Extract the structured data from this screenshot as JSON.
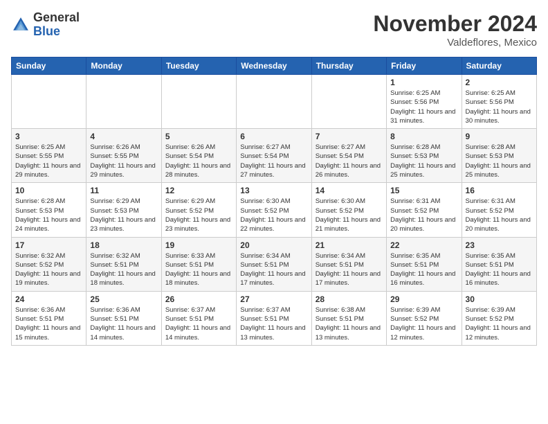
{
  "header": {
    "logo_general": "General",
    "logo_blue": "Blue",
    "month_title": "November 2024",
    "location": "Valdeflores, Mexico"
  },
  "days_of_week": [
    "Sunday",
    "Monday",
    "Tuesday",
    "Wednesday",
    "Thursday",
    "Friday",
    "Saturday"
  ],
  "weeks": [
    [
      {
        "day": "",
        "info": ""
      },
      {
        "day": "",
        "info": ""
      },
      {
        "day": "",
        "info": ""
      },
      {
        "day": "",
        "info": ""
      },
      {
        "day": "",
        "info": ""
      },
      {
        "day": "1",
        "info": "Sunrise: 6:25 AM\nSunset: 5:56 PM\nDaylight: 11 hours and 31 minutes."
      },
      {
        "day": "2",
        "info": "Sunrise: 6:25 AM\nSunset: 5:56 PM\nDaylight: 11 hours and 30 minutes."
      }
    ],
    [
      {
        "day": "3",
        "info": "Sunrise: 6:25 AM\nSunset: 5:55 PM\nDaylight: 11 hours and 29 minutes."
      },
      {
        "day": "4",
        "info": "Sunrise: 6:26 AM\nSunset: 5:55 PM\nDaylight: 11 hours and 29 minutes."
      },
      {
        "day": "5",
        "info": "Sunrise: 6:26 AM\nSunset: 5:54 PM\nDaylight: 11 hours and 28 minutes."
      },
      {
        "day": "6",
        "info": "Sunrise: 6:27 AM\nSunset: 5:54 PM\nDaylight: 11 hours and 27 minutes."
      },
      {
        "day": "7",
        "info": "Sunrise: 6:27 AM\nSunset: 5:54 PM\nDaylight: 11 hours and 26 minutes."
      },
      {
        "day": "8",
        "info": "Sunrise: 6:28 AM\nSunset: 5:53 PM\nDaylight: 11 hours and 25 minutes."
      },
      {
        "day": "9",
        "info": "Sunrise: 6:28 AM\nSunset: 5:53 PM\nDaylight: 11 hours and 25 minutes."
      }
    ],
    [
      {
        "day": "10",
        "info": "Sunrise: 6:28 AM\nSunset: 5:53 PM\nDaylight: 11 hours and 24 minutes."
      },
      {
        "day": "11",
        "info": "Sunrise: 6:29 AM\nSunset: 5:53 PM\nDaylight: 11 hours and 23 minutes."
      },
      {
        "day": "12",
        "info": "Sunrise: 6:29 AM\nSunset: 5:52 PM\nDaylight: 11 hours and 23 minutes."
      },
      {
        "day": "13",
        "info": "Sunrise: 6:30 AM\nSunset: 5:52 PM\nDaylight: 11 hours and 22 minutes."
      },
      {
        "day": "14",
        "info": "Sunrise: 6:30 AM\nSunset: 5:52 PM\nDaylight: 11 hours and 21 minutes."
      },
      {
        "day": "15",
        "info": "Sunrise: 6:31 AM\nSunset: 5:52 PM\nDaylight: 11 hours and 20 minutes."
      },
      {
        "day": "16",
        "info": "Sunrise: 6:31 AM\nSunset: 5:52 PM\nDaylight: 11 hours and 20 minutes."
      }
    ],
    [
      {
        "day": "17",
        "info": "Sunrise: 6:32 AM\nSunset: 5:52 PM\nDaylight: 11 hours and 19 minutes."
      },
      {
        "day": "18",
        "info": "Sunrise: 6:32 AM\nSunset: 5:51 PM\nDaylight: 11 hours and 18 minutes."
      },
      {
        "day": "19",
        "info": "Sunrise: 6:33 AM\nSunset: 5:51 PM\nDaylight: 11 hours and 18 minutes."
      },
      {
        "day": "20",
        "info": "Sunrise: 6:34 AM\nSunset: 5:51 PM\nDaylight: 11 hours and 17 minutes."
      },
      {
        "day": "21",
        "info": "Sunrise: 6:34 AM\nSunset: 5:51 PM\nDaylight: 11 hours and 17 minutes."
      },
      {
        "day": "22",
        "info": "Sunrise: 6:35 AM\nSunset: 5:51 PM\nDaylight: 11 hours and 16 minutes."
      },
      {
        "day": "23",
        "info": "Sunrise: 6:35 AM\nSunset: 5:51 PM\nDaylight: 11 hours and 16 minutes."
      }
    ],
    [
      {
        "day": "24",
        "info": "Sunrise: 6:36 AM\nSunset: 5:51 PM\nDaylight: 11 hours and 15 minutes."
      },
      {
        "day": "25",
        "info": "Sunrise: 6:36 AM\nSunset: 5:51 PM\nDaylight: 11 hours and 14 minutes."
      },
      {
        "day": "26",
        "info": "Sunrise: 6:37 AM\nSunset: 5:51 PM\nDaylight: 11 hours and 14 minutes."
      },
      {
        "day": "27",
        "info": "Sunrise: 6:37 AM\nSunset: 5:51 PM\nDaylight: 11 hours and 13 minutes."
      },
      {
        "day": "28",
        "info": "Sunrise: 6:38 AM\nSunset: 5:51 PM\nDaylight: 11 hours and 13 minutes."
      },
      {
        "day": "29",
        "info": "Sunrise: 6:39 AM\nSunset: 5:52 PM\nDaylight: 11 hours and 12 minutes."
      },
      {
        "day": "30",
        "info": "Sunrise: 6:39 AM\nSunset: 5:52 PM\nDaylight: 11 hours and 12 minutes."
      }
    ]
  ]
}
